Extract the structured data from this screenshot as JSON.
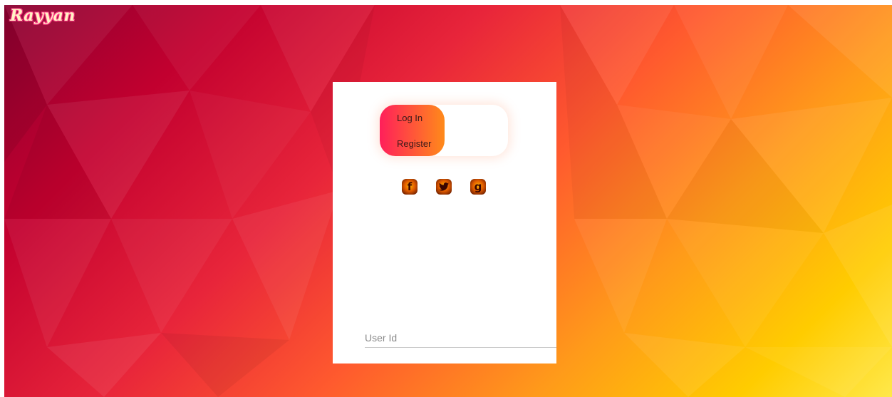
{
  "brand": {
    "logo_text": "Rayyan"
  },
  "auth": {
    "tabs": {
      "login_label": "Log In",
      "register_label": "Register",
      "active": "login"
    },
    "social": [
      {
        "name": "facebook",
        "icon": "facebook-icon",
        "glyph": "f"
      },
      {
        "name": "twitter",
        "icon": "twitter-icon",
        "glyph": "t"
      },
      {
        "name": "google",
        "icon": "google-icon",
        "glyph": "g"
      }
    ],
    "fields": {
      "user_id_placeholder": "User Id",
      "user_id_value": ""
    }
  },
  "colors": {
    "gradient_start": "#ff1f5a",
    "gradient_end": "#ff8a1a",
    "background_dark": "#8a0030",
    "background_light": "#ffe84a"
  }
}
